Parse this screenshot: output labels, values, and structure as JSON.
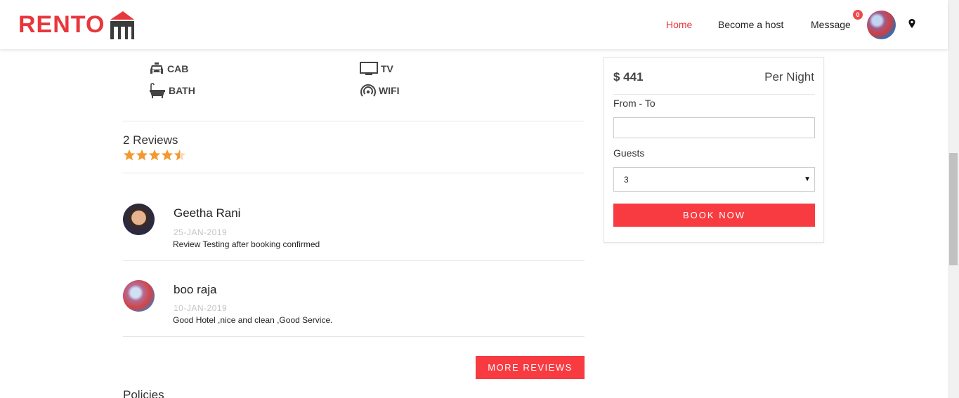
{
  "brand": {
    "logo_text": "RENTO",
    "accent_color": "#e8373c"
  },
  "nav": {
    "home": "Home",
    "become_host": "Become a host",
    "message": "Message",
    "message_badge": "0",
    "location_icon": "map-pin-icon"
  },
  "amenities": [
    {
      "label": "CAB",
      "icon": "cab-icon"
    },
    {
      "label": "TV",
      "icon": "tv-icon"
    },
    {
      "label": "BATH",
      "icon": "bath-icon"
    },
    {
      "label": "WIFI",
      "icon": "wifi-icon"
    }
  ],
  "reviews": {
    "count_label": "2 Reviews",
    "rating": 4.5,
    "rating_max": 5,
    "items": [
      {
        "name": "Geetha Rani",
        "date": "25-JAN-2019",
        "text": "Review Testing after booking confirmed"
      },
      {
        "name": "boo raja",
        "date": "10-JAN-2019",
        "text": "Good Hotel ,nice and clean ,Good Service."
      }
    ],
    "more_button": "MORE REVIEWS"
  },
  "policies_heading": "Policies",
  "booking": {
    "price": "$ 441",
    "per_night": "Per Night",
    "from_to_label": "From - To",
    "from_to_value": "",
    "guests_label": "Guests",
    "guests_value": "3",
    "book_button": "BOOK NOW"
  }
}
